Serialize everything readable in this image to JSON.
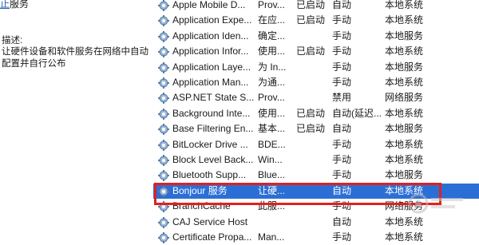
{
  "left_pane": {
    "service_link": "服务",
    "service_link_prefix": "止",
    "description_label": "描述:",
    "description_text": "让硬件设备和软件服务在网络中自动配置并自行公布"
  },
  "services": [
    {
      "name": "Apple Mobile D...",
      "description": "Prov...",
      "status": "已启动",
      "startup": "自动",
      "logon": "本地系统"
    },
    {
      "name": "Application Expe...",
      "description": "在应...",
      "status": "已启动",
      "startup": "手动",
      "logon": "本地系统"
    },
    {
      "name": "Application Iden...",
      "description": "确定...",
      "status": "",
      "startup": "手动",
      "logon": "本地服务"
    },
    {
      "name": "Application Infor...",
      "description": "使用...",
      "status": "已启动",
      "startup": "手动",
      "logon": "本地系统"
    },
    {
      "name": "Application Laye...",
      "description": "为 In...",
      "status": "",
      "startup": "手动",
      "logon": "本地服务"
    },
    {
      "name": "Application Man...",
      "description": "为通...",
      "status": "",
      "startup": "手动",
      "logon": "本地系统"
    },
    {
      "name": "ASP.NET State S...",
      "description": "Prov...",
      "status": "",
      "startup": "禁用",
      "logon": "网络服务"
    },
    {
      "name": "Background Inte...",
      "description": "使用...",
      "status": "已启动",
      "startup": "自动(延迟...",
      "logon": "本地系统"
    },
    {
      "name": "Base Filtering En...",
      "description": "基本...",
      "status": "已启动",
      "startup": "自动",
      "logon": "本地服务"
    },
    {
      "name": "BitLocker Drive ...",
      "description": "BDE...",
      "status": "",
      "startup": "手动",
      "logon": "本地系统"
    },
    {
      "name": "Block Level Back...",
      "description": "Win...",
      "status": "",
      "startup": "手动",
      "logon": "本地系统"
    },
    {
      "name": "Bluetooth Supp...",
      "description": "Blue...",
      "status": "",
      "startup": "手动",
      "logon": "本地服务"
    },
    {
      "name": "Bonjour 服务",
      "description": "让硬...",
      "status": "",
      "startup": "自动",
      "logon": "本地系统"
    },
    {
      "name": "BranchCache",
      "description": "此服...",
      "status": "",
      "startup": "手动",
      "logon": "网络服务"
    },
    {
      "name": "CAJ Service Host",
      "description": "",
      "status": "",
      "startup": "自动",
      "logon": "本地系统"
    },
    {
      "name": "Certificate Propa...",
      "description": "Man...",
      "status": "",
      "startup": "手动",
      "logon": "本地系统"
    }
  ],
  "selected_index": 12,
  "colors": {
    "selection": "#2b6fd6",
    "highlight_border": "#e12020",
    "link": "#2a5db0"
  },
  "icons": {
    "service": "gear-icon",
    "watermark": "watermark-logo"
  }
}
